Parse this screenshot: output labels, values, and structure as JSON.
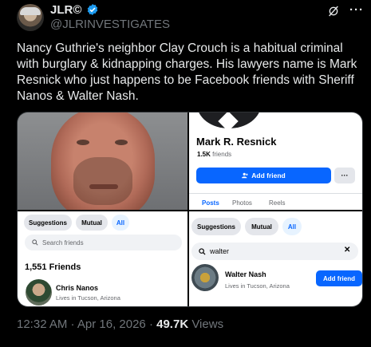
{
  "author": {
    "name": "JLR©",
    "handle": "@JLRINVESTIGATES"
  },
  "tweet": {
    "text": "Nancy Guthrie's neighbor Clay Crouch is a habitual criminal with burglary & kidnapping charges. His lawyers name is Mark Resnick who just happens to be Facebook friends with Sheriff Nanos & Walter Nash.",
    "time": "12:32 AM · Apr 16, 2026 ·",
    "views_count": "49.7K",
    "views_label": "Views"
  },
  "profile_card": {
    "name": "Mark R. Resnick",
    "friends_count": "1.5K",
    "friends_label": "friends",
    "add_friend_label": "Add friend",
    "more_label": "···",
    "tabs": [
      "Posts",
      "Photos",
      "Reels"
    ]
  },
  "friends_panel": {
    "chips": [
      "Suggestions",
      "Mutual",
      "All"
    ],
    "search_placeholder": "Search friends",
    "count_label": "1,551 Friends",
    "person": {
      "name": "Chris Nanos",
      "location": "Lives in Tucson, Arizona"
    }
  },
  "search_panel": {
    "chips": [
      "Suggestions",
      "Mutual",
      "All"
    ],
    "search_value": "walter",
    "person": {
      "name": "Walter Nash",
      "location": "Lives in Tucson, Arizona"
    },
    "add_friend_label": "Add friend"
  },
  "icons": {
    "verified": "verified-badge-icon",
    "grok": "grok-icon",
    "more": "more-icon",
    "search": "search-icon",
    "clear": "close-icon",
    "add_person": "add-person-icon"
  },
  "colors": {
    "background": "#000000",
    "text": "#e7e9ea",
    "muted": "#71767b",
    "verified": "#1d9bf0",
    "facebook_blue": "#0866ff"
  }
}
